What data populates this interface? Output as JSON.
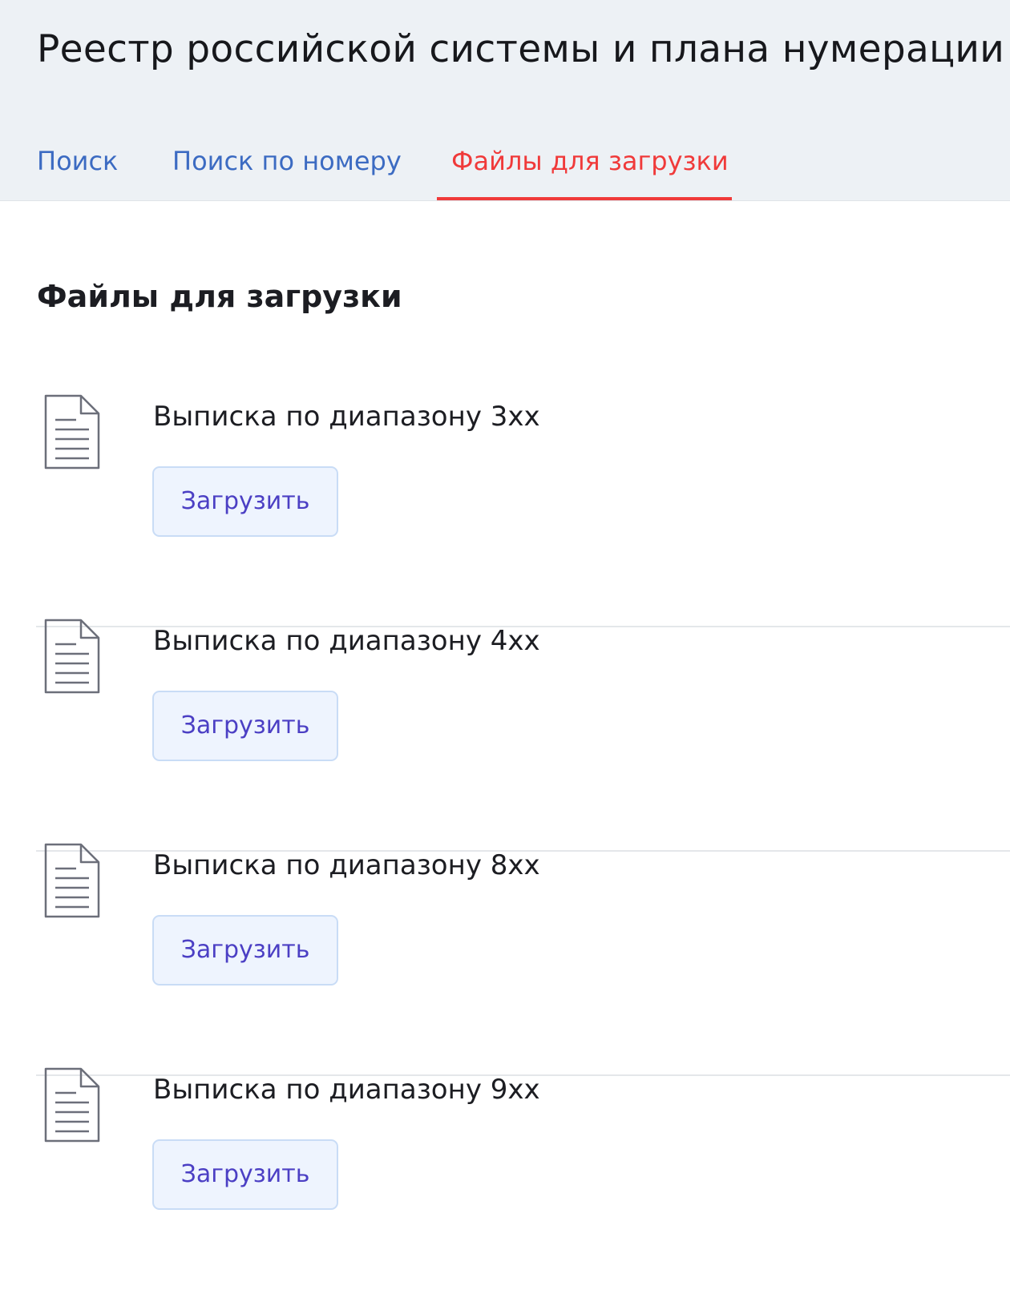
{
  "header": {
    "title": "Реестр российской системы и плана нумерации"
  },
  "tabs": [
    {
      "label": "Поиск",
      "active": false
    },
    {
      "label": "Поиск по номеру",
      "active": false
    },
    {
      "label": "Файлы для загрузки",
      "active": true
    }
  ],
  "main": {
    "section_title": "Файлы для загрузки",
    "files": [
      {
        "name": "Выписка по диапазону 3xx",
        "button_label": "Загрузить",
        "icon": "document-icon"
      },
      {
        "name": "Выписка по диапазону 4xx",
        "button_label": "Загрузить",
        "icon": "document-icon"
      },
      {
        "name": "Выписка по диапазону 8xx",
        "button_label": "Загрузить",
        "icon": "document-icon"
      },
      {
        "name": "Выписка по диапазону 9xx",
        "button_label": "Загрузить",
        "icon": "document-icon"
      }
    ]
  },
  "colors": {
    "header_background": "#edf1f5",
    "tab_link": "#3c6bc2",
    "tab_active": "#f03a3a",
    "button_background": "#eef4fe",
    "button_text": "#4b3fc4"
  }
}
